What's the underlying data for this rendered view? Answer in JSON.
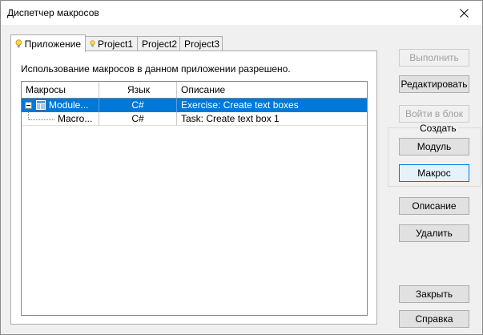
{
  "window": {
    "title": "Диспетчер макросов"
  },
  "tabs": [
    {
      "label": "Приложение",
      "active": true
    },
    {
      "label": "Project1",
      "active": false
    },
    {
      "label": "Project2",
      "active": false
    },
    {
      "label": "Project3",
      "active": false
    }
  ],
  "panel": {
    "status": "Использование макросов в данном приложении разрешено."
  },
  "grid": {
    "columns": [
      "Макросы",
      "Язык",
      "Описание"
    ],
    "rows": [
      {
        "name": "Module...",
        "language": "C#",
        "description": "Exercise: Create text boxes",
        "selected": true
      },
      {
        "name": "Macro...",
        "language": "C#",
        "description": "Task: Create text box 1",
        "selected": false
      }
    ]
  },
  "buttons": {
    "run": "Выполнить",
    "edit": "Редактировать",
    "step_into": "Войти в блок",
    "create_group": "Создать",
    "module": "Модуль",
    "macro": "Макрос",
    "description": "Описание",
    "delete": "Удалить",
    "close": "Закрыть",
    "help": "Справка"
  },
  "colors": {
    "selection": "#0078d7",
    "window_bg": "#f0f0f0",
    "button_bg": "#e1e1e1",
    "disabled_text": "#a0a0a0"
  }
}
